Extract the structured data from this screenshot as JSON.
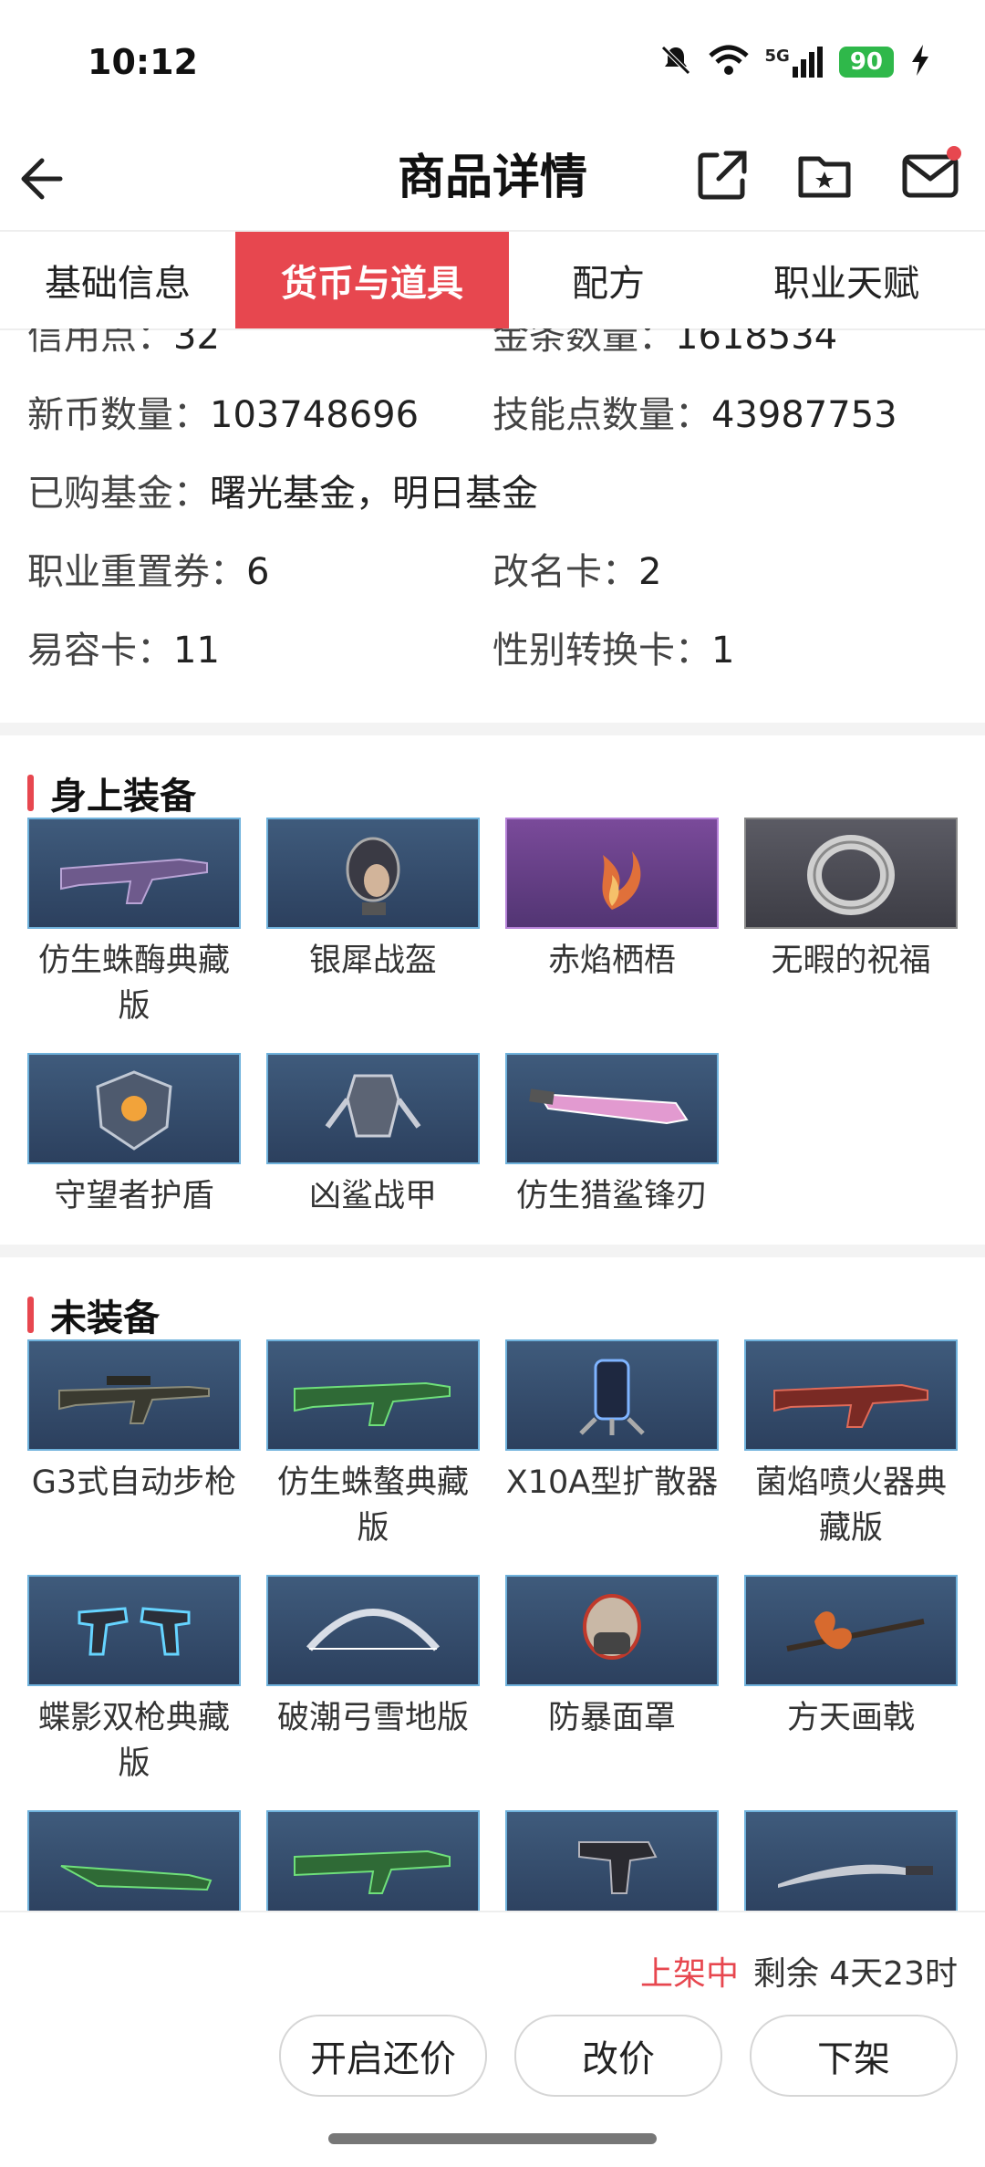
{
  "status_bar": {
    "time": "10:12",
    "network": "5G",
    "battery": "90"
  },
  "header": {
    "title": "商品详情",
    "icons": [
      "back-arrow-icon",
      "share-icon",
      "folder-star-icon",
      "mail-icon"
    ]
  },
  "tabs": [
    {
      "label": "基础信息",
      "active": false
    },
    {
      "label": "货币与道具",
      "active": true
    },
    {
      "label": "配方",
      "active": false
    },
    {
      "label": "职业天赋",
      "active": false
    }
  ],
  "info": {
    "credit": {
      "label": "信用点：",
      "value": "32"
    },
    "gold_bars": {
      "label": "金条数量：",
      "value": "1618534"
    },
    "new_coins": {
      "label": "新币数量：",
      "value": "103748696"
    },
    "skill_points": {
      "label": "技能点数量：",
      "value": "43987753"
    },
    "funds": {
      "label": "已购基金：",
      "value": "曙光基金，明日基金"
    },
    "reset_tickets": {
      "label": "职业重置券：",
      "value": "6"
    },
    "rename_cards": {
      "label": "改名卡：",
      "value": "2"
    },
    "disguise_cards": {
      "label": "易容卡：",
      "value": "11"
    },
    "gender_cards": {
      "label": "性别转换卡：",
      "value": "1"
    }
  },
  "equipped": {
    "title": "身上装备",
    "items": [
      "仿生蛛酶典藏版",
      "银犀战盔",
      "赤焰栖梧",
      "无暇的祝福",
      "守望者护盾",
      "凶鲨战甲",
      "仿生猎鲨锋刃"
    ]
  },
  "unequipped": {
    "title": "未装备",
    "items": [
      "G3式自动步枪",
      "仿生蛛螯典藏版",
      "X10A型扩散器",
      "菌焰喷火器典藏版",
      "蝶影双枪典藏版",
      "破潮弓雪地版",
      "防暴面罩",
      "方天画戟"
    ]
  },
  "bottom_bar": {
    "listing_status": "上架中",
    "remaining": "剩余 4天23时",
    "buttons": [
      "开启还价",
      "改价",
      "下架"
    ]
  },
  "colors": {
    "accent": "#e7474f",
    "battery": "#2fb84a",
    "thumb_border": "#6fb2dc"
  }
}
